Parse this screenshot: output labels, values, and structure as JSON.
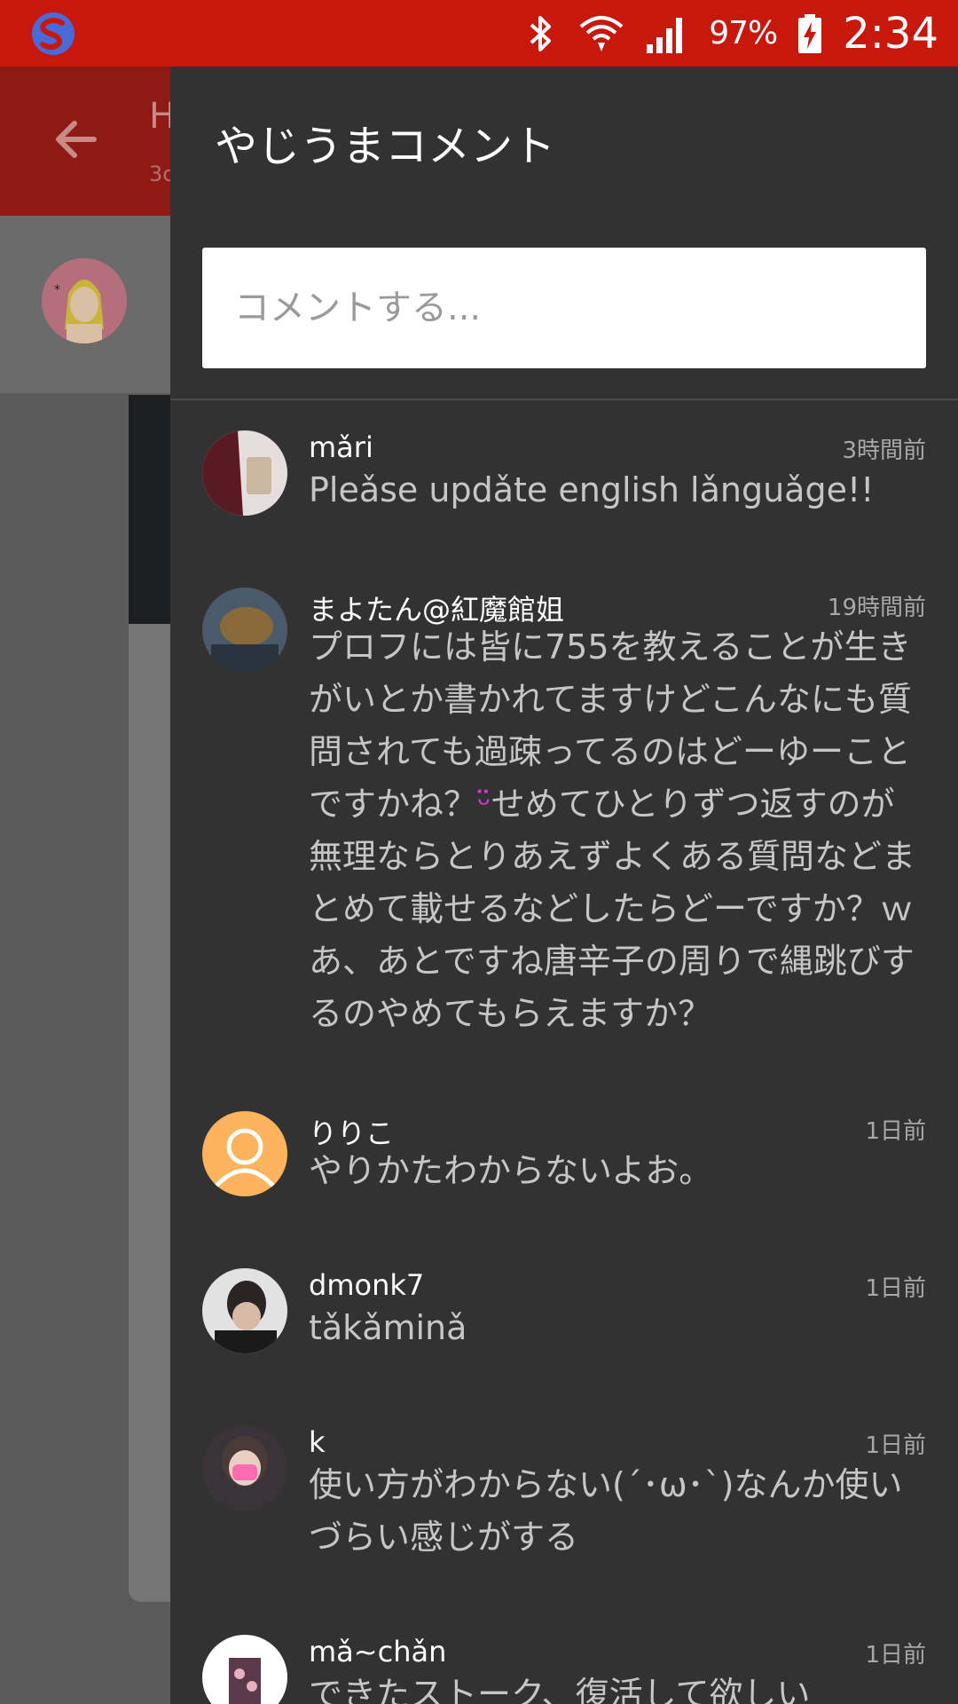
{
  "status_bar": {
    "battery_percent": "97%",
    "time": "2:34"
  },
  "background_screen": {
    "title_fragment": "H",
    "subtitle_fragment": "3c"
  },
  "drawer": {
    "title": "やじうまコメント",
    "comment_input": {
      "placeholder": "コメントする...",
      "value": ""
    },
    "comments": [
      {
        "name": "mǎri",
        "time": "3時間前",
        "text": "Pleǎse updǎte english lǎnguǎge!!"
      },
      {
        "name": "まよたん@紅魔館姐",
        "time": "19時間前",
        "text": "プロフには皆に755を教えることが生きがいとか書かれてますけどこんなにも質問されても過疎ってるのはどーゆーことですかね？",
        "text_after_emoji": "せめてひとりずつ返すのが無理ならとりあえずよくある質問などまとめて載せるなどしたらどーですか？ｗあ、あとですね唐辛子の周りで縄跳びするのやめてもらえますか？",
        "emoji": "ᵕ̈"
      },
      {
        "name": "りりこ",
        "time": "1日前",
        "text": "やりかたわからないよお。"
      },
      {
        "name": "dmonk7",
        "time": "1日前",
        "text": "tǎkǎminǎ"
      },
      {
        "name": "k",
        "time": "1日前",
        "text": "使い方がわからない(´･ω･`)なんか使いづらい感じがする"
      },
      {
        "name": "mǎ~chǎn",
        "time": "1日前",
        "text": "できたストーク、復活して欲しい"
      }
    ]
  },
  "colors": {
    "status_bar": "#c8170c",
    "drawer_bg": "#323232",
    "default_avatar": "#fdb35c"
  }
}
